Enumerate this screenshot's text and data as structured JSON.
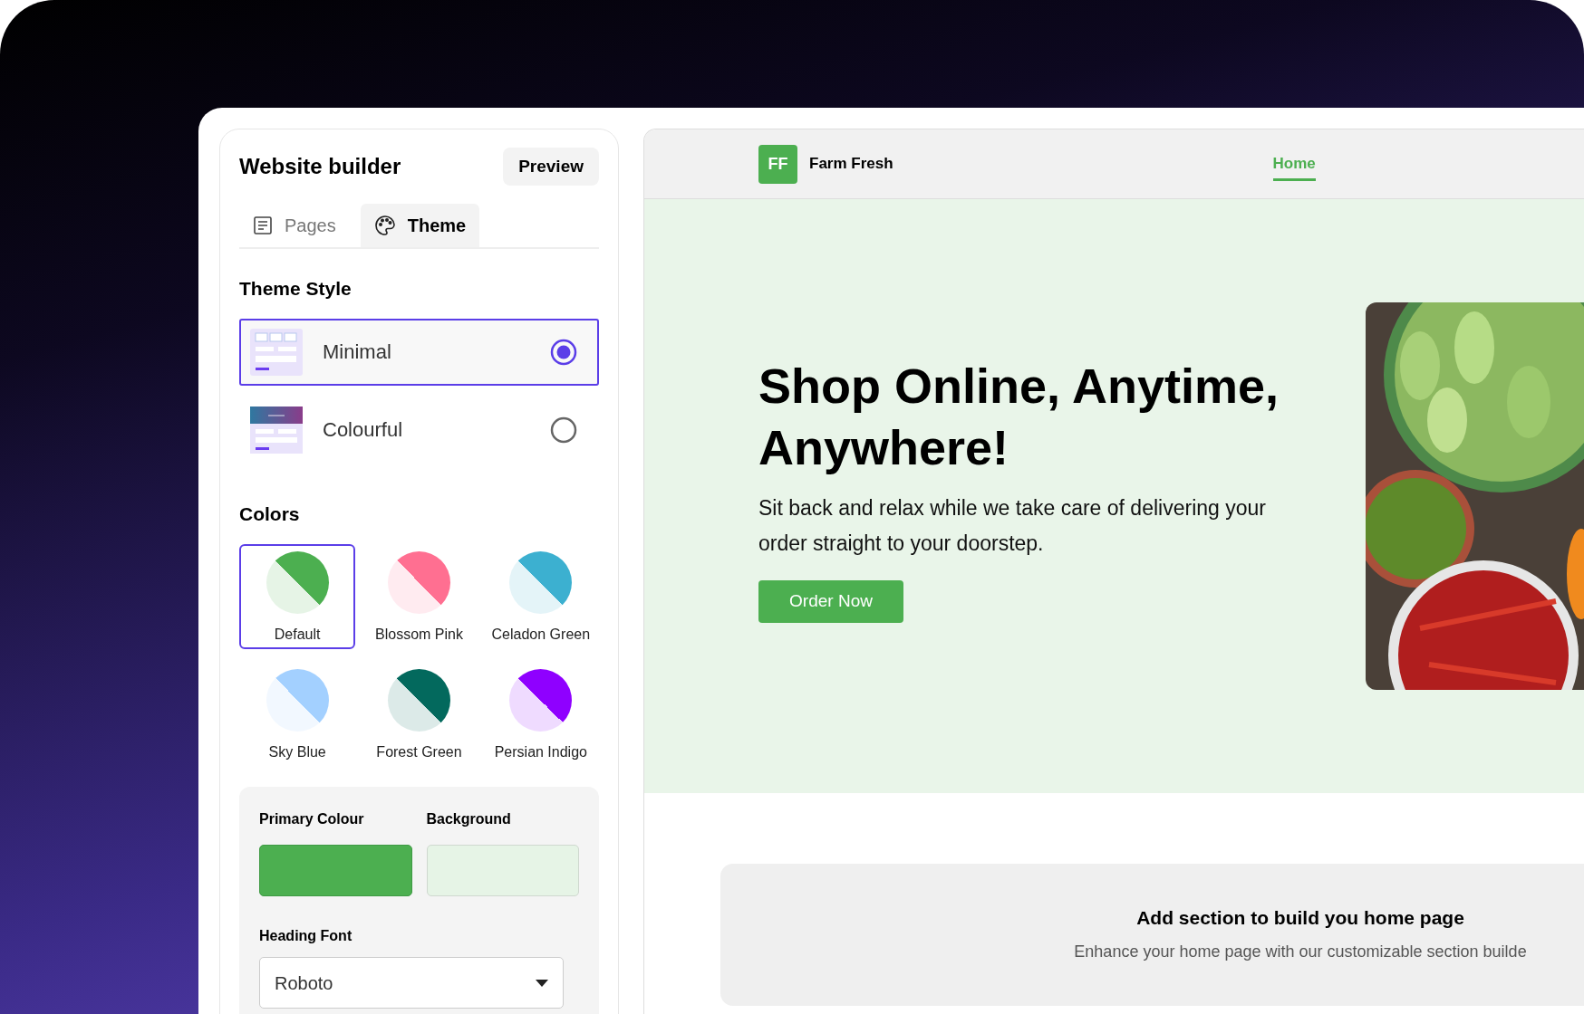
{
  "builder": {
    "title": "Website builder",
    "preview_button": "Preview",
    "tabs": [
      {
        "label": "Pages",
        "selected": false
      },
      {
        "label": "Theme",
        "selected": true
      }
    ],
    "theme_style": {
      "heading": "Theme Style",
      "options": [
        {
          "label": "Minimal",
          "kind": "minimal",
          "selected": true
        },
        {
          "label": "Colourful",
          "kind": "colourful",
          "selected": false
        }
      ]
    },
    "colors": {
      "heading": "Colors",
      "swatches": [
        {
          "label": "Default",
          "color": "#4caf50",
          "selected": true
        },
        {
          "label": "Blossom Pink",
          "color": "#ff6f91",
          "selected": false
        },
        {
          "label": "Celadon Green",
          "color": "#3cb0d0",
          "selected": false
        },
        {
          "label": "Sky Blue",
          "color": "#a3d0ff",
          "selected": false
        },
        {
          "label": "Forest Green",
          "color": "#03695d",
          "selected": false
        },
        {
          "label": "Persian Indigo",
          "color": "#8f00ff",
          "selected": false
        }
      ]
    },
    "custom": {
      "primary_label": "Primary Colour",
      "background_label": "Background",
      "font_label": "Heading Font",
      "font_value": "Roboto"
    }
  },
  "preview": {
    "brand_initials": "FF",
    "brand_name": "Farm Fresh",
    "nav": [
      {
        "label": "Home",
        "selected": true
      }
    ],
    "hero": {
      "heading": "Shop Online, Anytime, Anywhere!",
      "text": "Sit back and relax while we take care of delivering your order straight to your doorstep.",
      "button": "Order Now"
    },
    "empty_section": {
      "title": "Add section to build you home page",
      "text": "Enhance your home page with our customizable section builde"
    }
  }
}
